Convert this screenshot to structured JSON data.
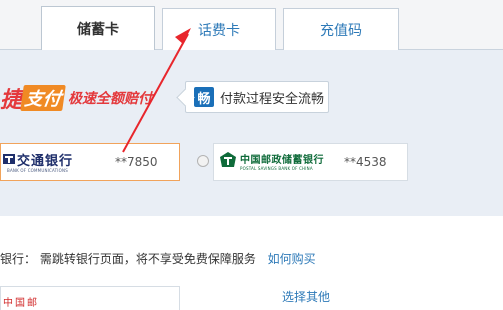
{
  "tabs": [
    {
      "label": "储蓄卡",
      "active": true
    },
    {
      "label": "话费卡",
      "active": false
    },
    {
      "label": "充值码",
      "active": false
    }
  ],
  "promo": {
    "logo_part1": "捷",
    "logo_part2": "支付",
    "slogan": "极速全额赔付",
    "secure_badge": "畅",
    "secure_text": "付款过程安全流畅"
  },
  "cards": [
    {
      "bank_name": "交通银行",
      "bank_name_en": "BANK OF COMMUNICATIONS",
      "masked": "**7850",
      "selected": true
    },
    {
      "bank_name": "中国邮政储蓄银行",
      "bank_name_en": "POSTAL SAVINGS BANK OF CHINA",
      "masked": "**4538",
      "selected": false
    }
  ],
  "info": {
    "text": "银行： 需跳转银行页面，将不享受免费保障服务",
    "link": "如何购买"
  },
  "select_other": "选择其他",
  "bottom_card_fragment": "中国邮"
}
